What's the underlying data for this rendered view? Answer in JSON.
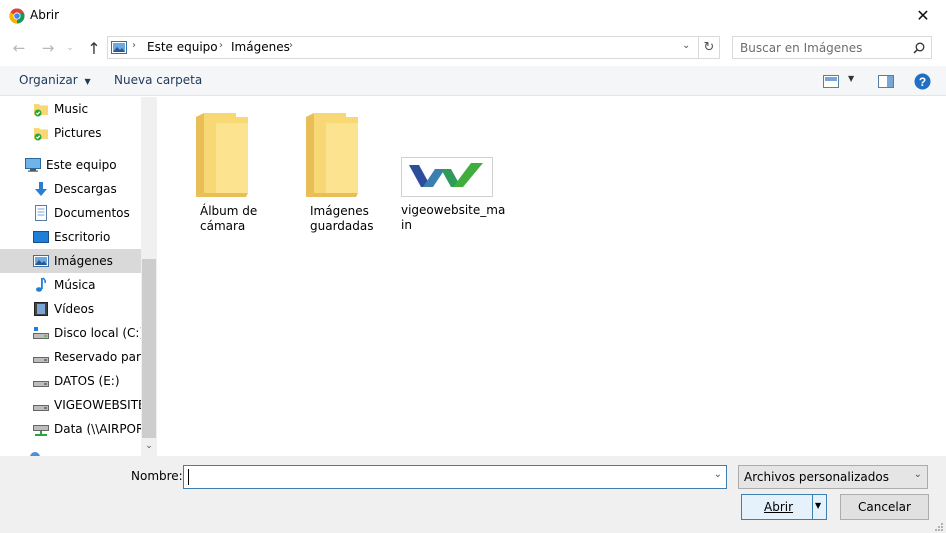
{
  "window": {
    "title": "Abrir"
  },
  "breadcrumb": [
    "Este equipo",
    "Imágenes"
  ],
  "search": {
    "placeholder": "Buscar en Imágenes"
  },
  "toolbar": {
    "organize_label": "Organizar",
    "new_folder_label": "Nueva carpeta"
  },
  "nav": {
    "items": [
      {
        "label": "Music",
        "icon": "folder-check-icon"
      },
      {
        "label": "Pictures",
        "icon": "folder-check-icon"
      },
      {
        "label": "Este equipo",
        "icon": "computer-icon"
      },
      {
        "label": "Descargas",
        "icon": "download-icon"
      },
      {
        "label": "Documentos",
        "icon": "documents-icon"
      },
      {
        "label": "Escritorio",
        "icon": "desktop-icon"
      },
      {
        "label": "Imágenes",
        "icon": "pictures-icon"
      },
      {
        "label": "Música",
        "icon": "music-icon"
      },
      {
        "label": "Vídeos",
        "icon": "video-icon"
      },
      {
        "label": "Disco local (C:)",
        "icon": "drive-icon"
      },
      {
        "label": "Reservado para e",
        "icon": "drive-icon"
      },
      {
        "label": "DATOS (E:)",
        "icon": "drive-icon"
      },
      {
        "label": "VIGEOWEBSITE (",
        "icon": "drive-icon"
      },
      {
        "label": "Data (\\\\AIRPORT",
        "icon": "network-drive-icon"
      }
    ]
  },
  "files": [
    {
      "line1": "Álbum de",
      "line2": "cámara"
    },
    {
      "line1": "Imágenes",
      "line2": "guardadas"
    },
    {
      "line1": "vigeowebsite_ma",
      "line2": "in"
    }
  ],
  "bottom": {
    "name_label": "Nombre:",
    "filename_value": "",
    "filter_value": "Archivos personalizados",
    "open_label": "Abrir",
    "cancel_label": "Cancelar"
  },
  "colors": {
    "accent": "#0078d7",
    "folder": "#f8d775",
    "selection": "#d9d9d9"
  }
}
